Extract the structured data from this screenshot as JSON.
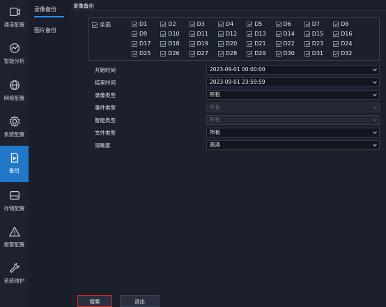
{
  "nav": [
    {
      "label": "通道配置",
      "icon": "camera-icon"
    },
    {
      "label": "智能分析",
      "icon": "analysis-icon"
    },
    {
      "label": "网络配置",
      "icon": "globe-icon"
    },
    {
      "label": "系统配置",
      "icon": "gear-icon"
    },
    {
      "label": "备份",
      "icon": "backup-icon"
    },
    {
      "label": "存储配置",
      "icon": "storage-icon"
    },
    {
      "label": "报警配置",
      "icon": "warning-icon"
    },
    {
      "label": "系统维护",
      "icon": "wrench-icon"
    }
  ],
  "active_nav": "备份",
  "subnav": [
    {
      "label": "录像备份"
    },
    {
      "label": "图片备份"
    }
  ],
  "tab": "录像备份",
  "select_all": "全选",
  "channels": [
    "D1",
    "D2",
    "D3",
    "D4",
    "D5",
    "D6",
    "D7",
    "D8",
    "D9",
    "D10",
    "D11",
    "D12",
    "D13",
    "D14",
    "D15",
    "D16",
    "D17",
    "D18",
    "D19",
    "D20",
    "D21",
    "D22",
    "D23",
    "D24",
    "D25",
    "D26",
    "D27",
    "D28",
    "D29",
    "D30",
    "D31",
    "D32"
  ],
  "form": [
    {
      "label": "开始时间",
      "value": "2023-09-01 00:00:00",
      "disabled": false
    },
    {
      "label": "结束时间",
      "value": "2023-09-01 23:59:59",
      "disabled": false
    },
    {
      "label": "录像类型",
      "value": "所有",
      "disabled": false
    },
    {
      "label": "事件类型",
      "value": "所有",
      "disabled": true
    },
    {
      "label": "智能类型",
      "value": "所有",
      "disabled": true
    },
    {
      "label": "文件类型",
      "value": "所有",
      "disabled": false
    },
    {
      "label": "清晰度",
      "value": "高清",
      "disabled": false
    }
  ],
  "buttons": {
    "search": "搜索",
    "exit": "退出"
  },
  "colors": {
    "accent": "#2178c8",
    "highlight_border": "#e02424"
  }
}
